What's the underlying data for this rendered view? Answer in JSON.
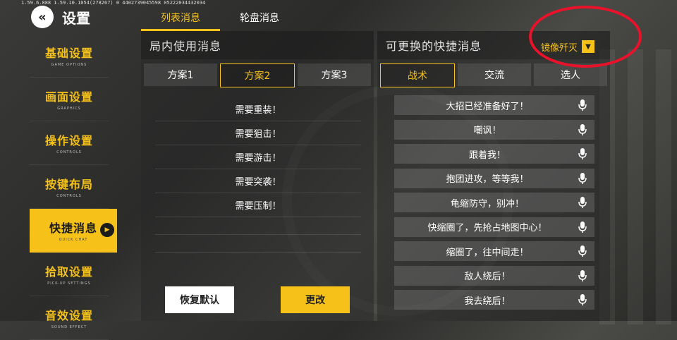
{
  "version_text": "1.59.6.888 1.59.10.1054(278267) 0 4402739045598 05222034432034",
  "header": {
    "title": "设置"
  },
  "sidebar": {
    "items": [
      {
        "label": "基础设置",
        "sub": "GAME OPTIONS"
      },
      {
        "label": "画面设置",
        "sub": "GRAPHICS"
      },
      {
        "label": "操作设置",
        "sub": "CONTROLS"
      },
      {
        "label": "按键布局",
        "sub": "CONTROLS"
      },
      {
        "label": "快捷消息",
        "sub": "QUICK CHAT"
      },
      {
        "label": "拾取设置",
        "sub": "PICK-UP SETTINGS"
      },
      {
        "label": "音效设置",
        "sub": "SOUND EFFECT"
      }
    ],
    "active_index": 4
  },
  "top_tabs": [
    {
      "label": "列表消息"
    },
    {
      "label": "轮盘消息"
    }
  ],
  "left_panel": {
    "title": "局内使用消息",
    "plans": [
      {
        "label": "方案1"
      },
      {
        "label": "方案2"
      },
      {
        "label": "方案3"
      }
    ],
    "messages": [
      "需要重装！",
      "需要狙击！",
      "需要游击！",
      "需要突袭！",
      "需要压制！"
    ],
    "reset_label": "恢复默认",
    "change_label": "更改"
  },
  "right_panel": {
    "title": "可更换的快捷消息",
    "dropdown_value": "镜像歼灭",
    "categories": [
      {
        "label": "战术"
      },
      {
        "label": "交流"
      },
      {
        "label": "选人"
      }
    ],
    "messages": [
      "大招已经准备好了！",
      "嘲讽！",
      "跟着我！",
      "抱团进攻，等等我！",
      "龟缩防守，别冲！",
      "快缩圈了，先抢占地图中心！",
      "缩圈了，往中间走！",
      "敌人绕后！",
      "我去绕后！"
    ]
  },
  "colors": {
    "accent": "#f6c21a",
    "annotation": "#e8132b"
  }
}
